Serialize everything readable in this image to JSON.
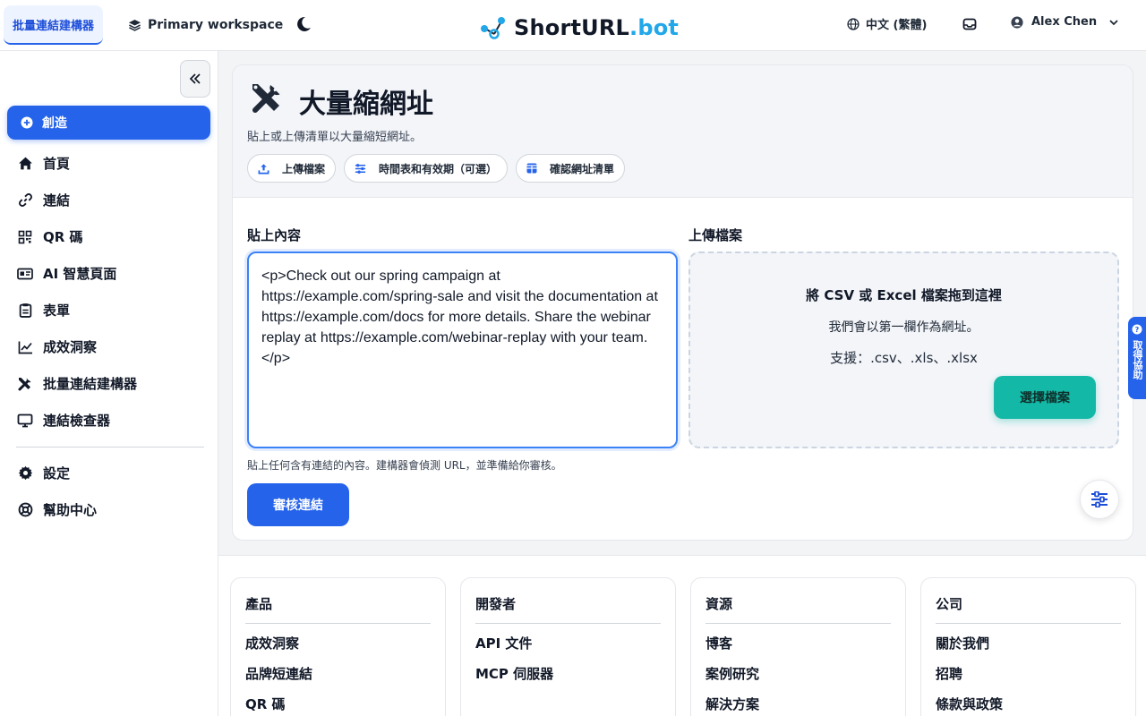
{
  "header": {
    "active_tab": "批量連結建構器",
    "workspace": "Primary workspace",
    "brand": {
      "name": "ShortURL",
      "suffix": ".bot"
    },
    "language": "中文 (繁體)",
    "user_name": "Alex Chen"
  },
  "sidebar": {
    "create_label": "創造",
    "items": [
      {
        "label": "首頁",
        "icon": "home-icon"
      },
      {
        "label": "連結",
        "icon": "link-icon"
      },
      {
        "label": "QR 碼",
        "icon": "qr-code-icon"
      },
      {
        "label": "AI 智慧頁面",
        "icon": "id-card-icon"
      },
      {
        "label": "表單",
        "icon": "clipboard-icon"
      },
      {
        "label": "成效洞察",
        "icon": "chart-line-icon"
      },
      {
        "label": "批量連結建構器",
        "icon": "tools-icon"
      },
      {
        "label": "連結檢查器",
        "icon": "monitor-icon"
      }
    ],
    "bottom_items": [
      {
        "label": "設定",
        "icon": "gear-icon"
      },
      {
        "label": "幫助中心",
        "icon": "lifebuoy-icon"
      }
    ]
  },
  "page": {
    "title": "大量縮網址",
    "subtitle": "貼上或上傳清單以大量縮短網址。",
    "chips": [
      "上傳檔案",
      "時間表和有效期（可選）",
      "確認網址清單"
    ],
    "paste_label": "貼上內容",
    "paste_value": "<p>Check out our spring campaign at https://example.com/spring-sale and visit the documentation at https://example.com/docs for more details. Share the webinar replay at https://example.com/webinar-replay with your team.</p>",
    "paste_helper": "貼上任何含有連結的內容。建構器會偵測 URL，並準備給你審核。",
    "review_button": "審核連結",
    "upload_label": "上傳檔案",
    "drop_title": "將 CSV 或 Excel 檔案拖到這裡",
    "drop_sub": "我們會以第一欄作為網址。",
    "drop_supported": "支援：.csv、.xls、.xlsx",
    "choose_button": "選擇檔案",
    "feedback_label": "取得協助"
  },
  "footer": {
    "columns": [
      {
        "title": "產品",
        "links": [
          "成效洞察",
          "品牌短連結",
          "QR 碼"
        ]
      },
      {
        "title": "開發者",
        "links": [
          "API 文件",
          "MCP 伺服器"
        ]
      },
      {
        "title": "資源",
        "links": [
          "博客",
          "案例研究",
          "解決方案"
        ]
      },
      {
        "title": "公司",
        "links": [
          "關於我們",
          "招聘",
          "條款與政策"
        ]
      }
    ]
  }
}
